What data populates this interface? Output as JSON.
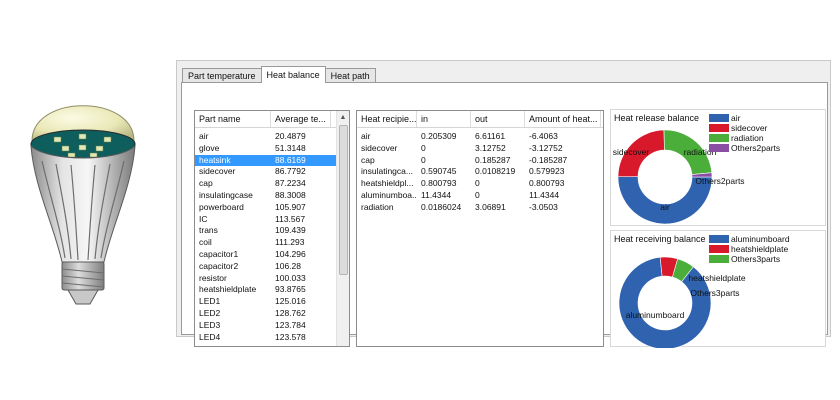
{
  "tabs": [
    {
      "label": "Part temperature",
      "active": false
    },
    {
      "label": "Heat balance",
      "active": true
    },
    {
      "label": "Heat path",
      "active": false
    }
  ],
  "parts_table": {
    "columns": [
      "Part name",
      "Average te..."
    ],
    "rows": [
      {
        "name": "air",
        "value": "20.4879"
      },
      {
        "name": "glove",
        "value": "51.3148"
      },
      {
        "name": "heatsink",
        "value": "88.6169",
        "selected": true
      },
      {
        "name": "sidecover",
        "value": "86.7792"
      },
      {
        "name": "cap",
        "value": "87.2234"
      },
      {
        "name": "insulatingcase",
        "value": "88.3008"
      },
      {
        "name": "powerboard",
        "value": "105.907"
      },
      {
        "name": "IC",
        "value": "113.567"
      },
      {
        "name": "trans",
        "value": "109.439"
      },
      {
        "name": "coil",
        "value": "111.293"
      },
      {
        "name": "capacitor1",
        "value": "104.296"
      },
      {
        "name": "capacitor2",
        "value": "106.28"
      },
      {
        "name": "resistor",
        "value": "100.033"
      },
      {
        "name": "heatshieldplate",
        "value": "93.8765"
      },
      {
        "name": "LED1",
        "value": "125.016"
      },
      {
        "name": "LED2",
        "value": "128.762"
      },
      {
        "name": "LED3",
        "value": "123.784"
      },
      {
        "name": "LED4",
        "value": "123.578"
      }
    ]
  },
  "heat_table": {
    "columns": [
      "Heat recipie...",
      "in",
      "out",
      "Amount of heat..."
    ],
    "rows": [
      [
        "air",
        "0.205309",
        "6.61161",
        "-6.4063"
      ],
      [
        "sidecover",
        "0",
        "3.12752",
        "-3.12752"
      ],
      [
        "cap",
        "0",
        "0.185287",
        "-0.185287"
      ],
      [
        "insulatingca...",
        "0.590745",
        "0.0108219",
        "0.579923"
      ],
      [
        "heatshieldpl...",
        "0.800793",
        "0",
        "0.800793"
      ],
      [
        "aluminumboa...",
        "11.4344",
        "0",
        "11.4344"
      ],
      [
        "radiation",
        "0.0186024",
        "3.06891",
        "-3.0503"
      ]
    ]
  },
  "chart_data": [
    {
      "type": "pie",
      "title": "Heat release balance",
      "categories": [
        "air",
        "sidecover",
        "radiation",
        "Others2parts"
      ],
      "values": [
        6.4063,
        3.12752,
        3.0503,
        0.185287
      ],
      "colors": [
        "#2f63b0",
        "#d8182b",
        "#4cae3a",
        "#8a4fa3"
      ],
      "slice_labels": [
        "air",
        "sidecover",
        "radiation",
        "Others2parts"
      ],
      "donut": true,
      "legend": "top-right"
    },
    {
      "type": "pie",
      "title": "Heat receiving balance",
      "categories": [
        "aluminumboard",
        "heatshieldplate",
        "Others3parts"
      ],
      "values": [
        11.4344,
        0.800793,
        0.79555
      ],
      "colors": [
        "#2f63b0",
        "#d8182b",
        "#4cae3a"
      ],
      "slice_labels": [
        "aluminumboard",
        "heatshieldplate",
        "Others3parts"
      ],
      "donut": true,
      "legend": "top-right"
    }
  ]
}
